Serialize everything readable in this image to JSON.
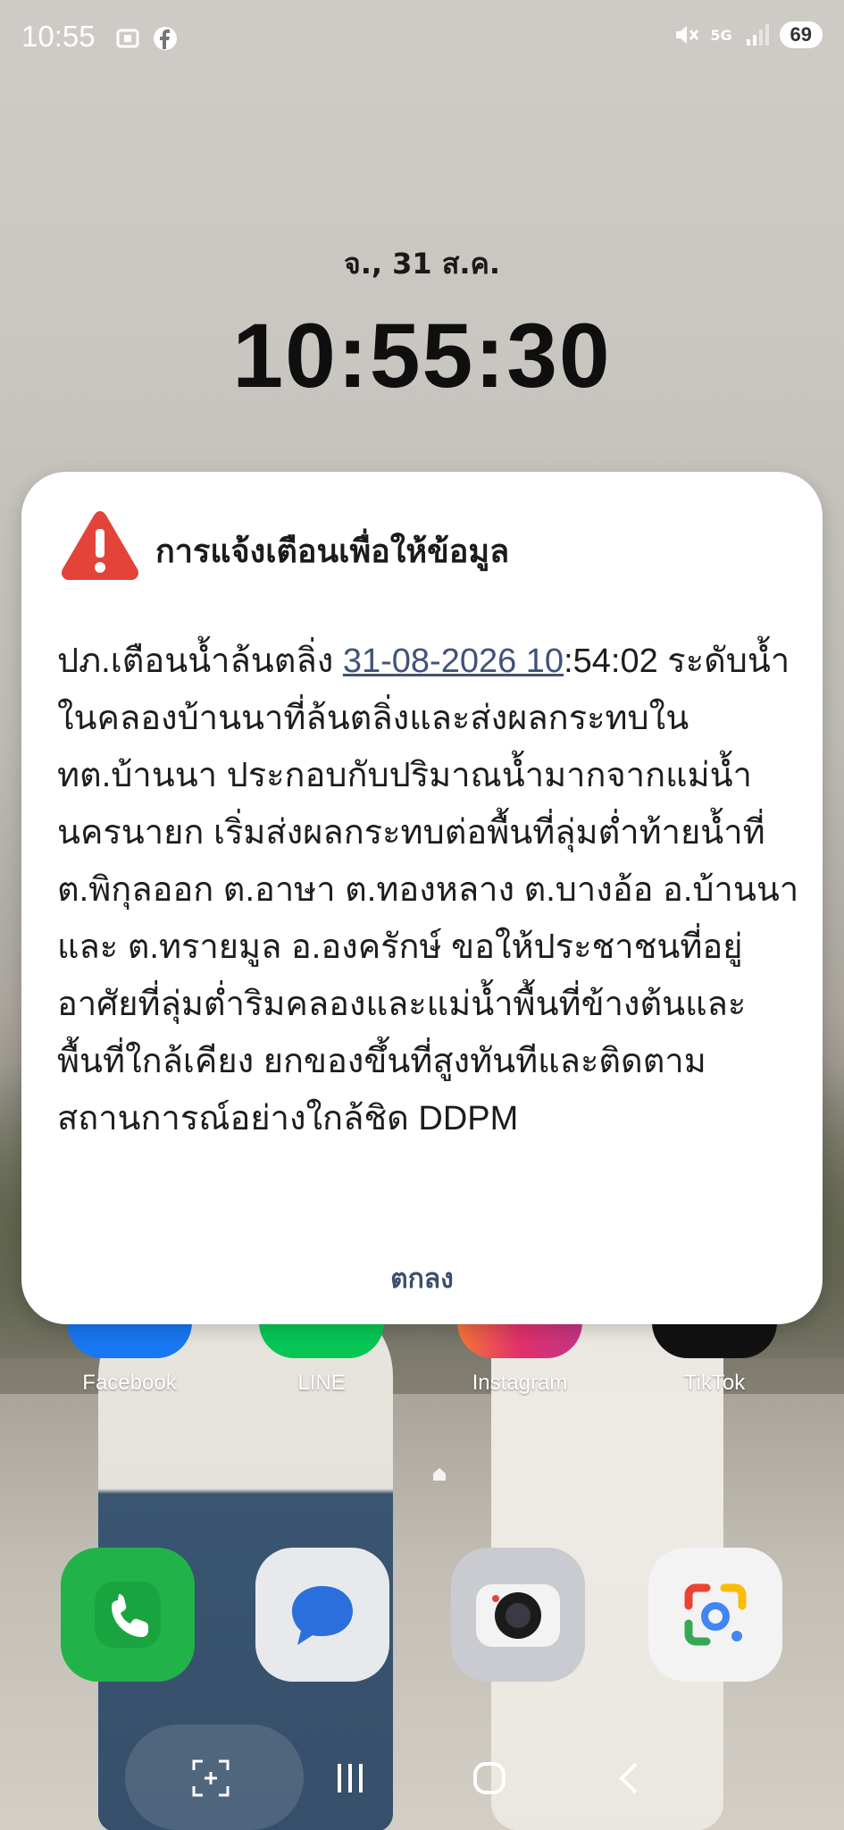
{
  "status_bar": {
    "time": "10:55",
    "left_icons": [
      "screenshot-icon",
      "facebook-icon"
    ],
    "right_icons": [
      "mute-icon",
      "5g-icon",
      "signal-icon"
    ],
    "network": "5G",
    "battery": "69"
  },
  "lock_screen": {
    "date": "จ., 31 ส.ค.",
    "time": "10:55:30"
  },
  "alert": {
    "title": "การแจ้งเตือนเพื่อให้ข้อมูล",
    "body_prefix": "ปภ.เตือนน้ำล้นตลิ่ง ",
    "body_link": "31-08-2026 10",
    "body_suffix": ":54:02 ระดับน้ำในคลองบ้านนาที่ล้นตลิ่งและส่งผลกระทบใน ทต.บ้านนา ประกอบกับปริมาณน้ำมากจากแม่น้ำนครนายก เริ่มส่งผลกระทบต่อพื้นที่ลุ่มต่ำท้ายน้ำที่ ต.พิกุลออก ต.อาษา ต.ทองหลาง ต.บางอ้อ อ.บ้านนา และ ต.ทรายมูล อ.องครักษ์ ขอให้ประชาชนที่อยู่อาศัยที่ลุ่มต่ำริมคลองและแม่น้ำพื้นที่ข้างต้นและพื้นที่ใกล้เคียง ยกของขึ้นที่สูงทันทีและติดตามสถานการณ์อย่างใกล้ชิด DDPM",
    "ok_label": "ตกลง",
    "accent_color": "#e4433a"
  },
  "home_apps": [
    {
      "label": "Facebook",
      "color": "#1877f2"
    },
    {
      "label": "LINE",
      "color": "#06c755"
    },
    {
      "label": "Instagram",
      "color": "#e1306c"
    },
    {
      "label": "TikTok",
      "color": "#111111"
    }
  ],
  "dock": [
    {
      "icon": "phone-icon",
      "color": "#1fb64c"
    },
    {
      "icon": "messages-icon",
      "color": "#2a6fdc"
    },
    {
      "icon": "camera-icon",
      "color": "#d8dadd"
    },
    {
      "icon": "google-lens-icon",
      "color": "#f1f1f1"
    }
  ],
  "nav_bar": [
    "recents-button",
    "home-button",
    "back-button"
  ]
}
